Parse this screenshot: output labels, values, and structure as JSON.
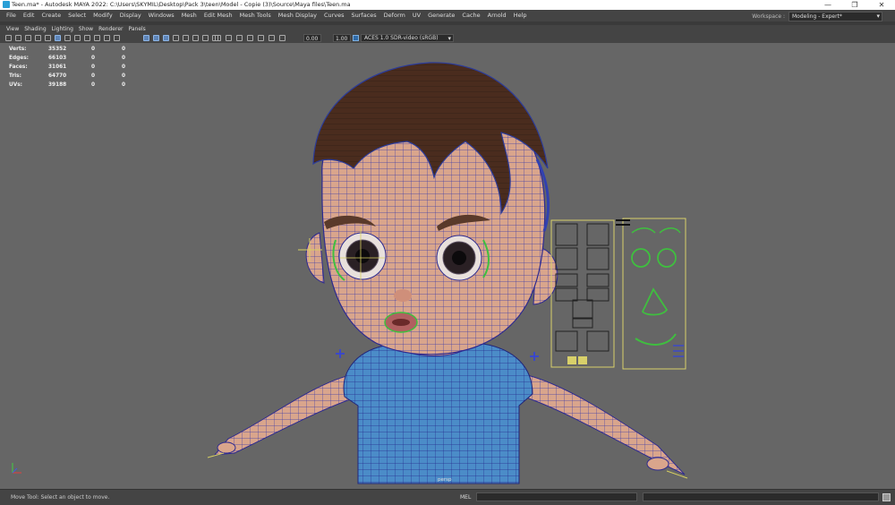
{
  "window": {
    "title": "Teen.ma* - Autodesk MAYA 2022: C:\\Users\\SKYMIL\\Desktop\\Pack 3\\teen\\Model - Copie (3)\\Source\\Maya files\\Teen.ma",
    "minimize_glyph": "—",
    "maximize_glyph": "❐",
    "close_glyph": "✕"
  },
  "menu": [
    "File",
    "Edit",
    "Create",
    "Select",
    "Modify",
    "Display",
    "Windows",
    "Mesh",
    "Edit Mesh",
    "Mesh Tools",
    "Mesh Display",
    "Curves",
    "Surfaces",
    "Deform",
    "UV",
    "Generate",
    "Cache",
    "Arnold",
    "Help"
  ],
  "workspace": {
    "label": "Workspace :",
    "value": "Modeling - Expert*"
  },
  "panel_menu": [
    "View",
    "Shading",
    "Lighting",
    "Show",
    "Renderer",
    "Panels"
  ],
  "toolbar": {
    "exposure": "0.00",
    "gamma": "1.00",
    "color_space": "ACES 1.0 SDR-video (sRGB)",
    "icons": [
      "camera-select-icon",
      "camera-attributes-icon",
      "bookmark-icon",
      "image-plane-icon",
      "2d-pan-icon",
      "grid-icon",
      "film-gate-icon",
      "resolution-gate-icon",
      "gate-mask-icon",
      "field-chart-icon",
      "safe-action-icon",
      "safe-title-icon",
      "wireframe-icon",
      "smooth-shade-icon",
      "wireframe-on-shaded-icon",
      "default-material-icon",
      "textured-icon",
      "use-all-lights-icon",
      "shadows-icon",
      "ambient-occlusion-icon",
      "motion-blur-icon",
      "anti-aliasing-icon",
      "depth-of-field-icon",
      "isolate-select-icon",
      "xray-icon",
      "xray-joints-icon",
      "backface-culling-icon"
    ]
  },
  "hud": {
    "rows": [
      {
        "label": "Verts:",
        "values": [
          "35352",
          "0",
          "0"
        ]
      },
      {
        "label": "Edges:",
        "values": [
          "66103",
          "0",
          "0"
        ]
      },
      {
        "label": "Faces:",
        "values": [
          "31061",
          "0",
          "0"
        ]
      },
      {
        "label": "Tris:",
        "values": [
          "64770",
          "0",
          "0"
        ]
      },
      {
        "label": "UVs:",
        "values": [
          "39188",
          "0",
          "0"
        ]
      }
    ]
  },
  "camera_label": "persp",
  "status": {
    "help_line": "Move Tool: Select an object to move.",
    "mel_label": "MEL"
  }
}
